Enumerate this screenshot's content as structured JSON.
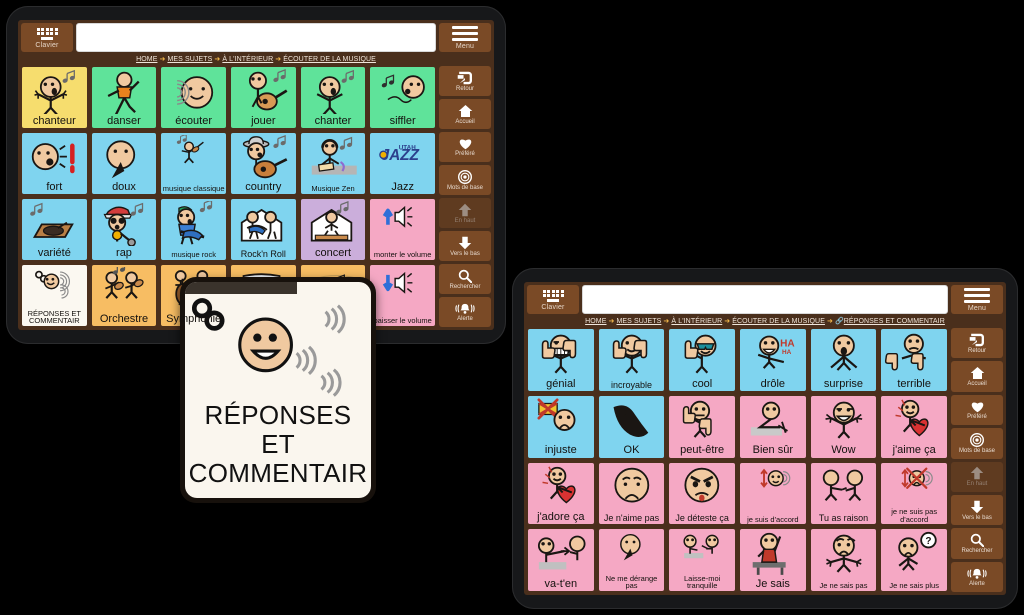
{
  "colors": {
    "bezel": "#17181a",
    "chrome_brown": "#4a2f1c",
    "key_brown": "#7a4a26",
    "yellow": "#f6dd6e",
    "green": "#5fe39a",
    "blue": "#7fd4ef",
    "pink": "#f5a8c4",
    "purple": "#cbaedb",
    "orange": "#f7bd63",
    "white": "#fbf8f1",
    "accent_arrow": "#f0b64a"
  },
  "topbar": {
    "keyboard_label": "Clavier",
    "keyboard_icon": "keyboard-icon",
    "menu_label": "Menu",
    "menu_icon": "hamburger-icon",
    "message_value": "",
    "message_placeholder": ""
  },
  "rail": {
    "items": [
      {
        "label": "Retour",
        "icon": "back-arrow-icon",
        "dim": false
      },
      {
        "label": "Accueil",
        "icon": "home-icon",
        "dim": false
      },
      {
        "label": "Préféré",
        "icon": "heart-icon",
        "dim": false
      },
      {
        "label": "Mots de base",
        "icon": "core-words-target-icon",
        "dim": false
      },
      {
        "label": "En haut",
        "icon": "arrow-up-icon",
        "dim": true
      },
      {
        "label": "Vers le bas",
        "icon": "arrow-down-icon",
        "dim": false
      },
      {
        "label": "Rechercher",
        "icon": "magnifier-icon",
        "dim": false
      },
      {
        "label": "Alerte",
        "icon": "bell-alert-icon",
        "dim": false
      }
    ]
  },
  "left_tablet": {
    "breadcrumb": [
      {
        "text": "HOME",
        "chain": false
      },
      {
        "text": "MES SUJETS",
        "chain": false
      },
      {
        "text": "À L'INTÉRIEUR",
        "chain": false
      },
      {
        "text": "ÉCOUTER DE LA MUSIQUE",
        "chain": false
      }
    ],
    "cells": [
      {
        "label": "chanteur",
        "color": "yellow",
        "size": "s1",
        "art": "singer"
      },
      {
        "label": "danser",
        "color": "green",
        "size": "s1",
        "art": "dance"
      },
      {
        "label": "écouter",
        "color": "green",
        "size": "s1",
        "art": "listen"
      },
      {
        "label": "jouer",
        "color": "green",
        "size": "s1",
        "art": "guitar"
      },
      {
        "label": "chanter",
        "color": "green",
        "size": "s1",
        "art": "sing"
      },
      {
        "label": "siffler",
        "color": "green",
        "size": "s1",
        "art": "whistle"
      },
      {
        "label": "fort",
        "color": "blue",
        "size": "s1",
        "art": "loud"
      },
      {
        "label": "doux",
        "color": "blue",
        "size": "s1",
        "art": "soft"
      },
      {
        "label": "musique classique",
        "color": "blue",
        "size": "s3",
        "art": "violin",
        "two": true
      },
      {
        "label": "country",
        "color": "blue",
        "size": "s1",
        "art": "country"
      },
      {
        "label": "Musique Zen",
        "color": "blue",
        "size": "s3",
        "art": "zen"
      },
      {
        "label": "Jazz",
        "color": "blue",
        "size": "s1",
        "art": "jazz"
      },
      {
        "label": "variété",
        "color": "blue",
        "size": "s1",
        "art": "gramophone"
      },
      {
        "label": "rap",
        "color": "blue",
        "size": "s1",
        "art": "rap"
      },
      {
        "label": "musique rock",
        "color": "blue",
        "size": "s3",
        "art": "rock"
      },
      {
        "label": "Rock'n Roll",
        "color": "blue",
        "size": "s2",
        "art": "rocknroll"
      },
      {
        "label": "concert",
        "color": "purple",
        "size": "s1",
        "art": "concert"
      },
      {
        "label": "monter le volume",
        "color": "pink",
        "size": "s3",
        "art": "volup",
        "two": true
      },
      {
        "label": "RÉPONSES ET COMMENTAIR",
        "color": "white",
        "size": "s3",
        "art": "comment",
        "two": true
      },
      {
        "label": "Orchestre",
        "color": "orange",
        "size": "s1",
        "art": "orchestra"
      },
      {
        "label": "Symphonie",
        "color": "orange",
        "size": "s1",
        "art": "symphony"
      },
      {
        "label": "",
        "color": "orange",
        "size": "s1",
        "art": "sheetmusic"
      },
      {
        "label": "",
        "color": "orange",
        "size": "s1",
        "art": "notes"
      },
      {
        "label": "baisser le volume",
        "color": "pink",
        "size": "s3",
        "art": "voldown",
        "two": true
      }
    ]
  },
  "right_tablet": {
    "breadcrumb": [
      {
        "text": "HOME",
        "chain": false
      },
      {
        "text": "MES SUJETS",
        "chain": false
      },
      {
        "text": "À L'INTÉRIEUR",
        "chain": false
      },
      {
        "text": "ÉCOUTER DE LA MUSIQUE",
        "chain": false
      },
      {
        "text": "RÉPONSES ET COMMENTAIR",
        "chain": true
      }
    ],
    "cells": [
      {
        "label": "génial",
        "color": "blue",
        "size": "s1",
        "art": "thumbsup-grin"
      },
      {
        "label": "incroyable",
        "color": "blue",
        "size": "s2",
        "art": "thumbsup-smile"
      },
      {
        "label": "cool",
        "color": "blue",
        "size": "s1",
        "art": "sunglasses"
      },
      {
        "label": "drôle",
        "color": "blue",
        "size": "s1",
        "art": "haha"
      },
      {
        "label": "surprise",
        "color": "blue",
        "size": "s1",
        "art": "surprise"
      },
      {
        "label": "terrible",
        "color": "blue",
        "size": "s1",
        "art": "thumbsdown"
      },
      {
        "label": "injuste",
        "color": "blue",
        "size": "s1",
        "art": "unfair"
      },
      {
        "label": "OK",
        "color": "blue",
        "size": "s1",
        "art": "ok-hand"
      },
      {
        "label": "peut-être",
        "color": "pink",
        "size": "s1",
        "art": "maybe"
      },
      {
        "label": "Bien sûr",
        "color": "pink",
        "size": "s1",
        "art": "ofcourse"
      },
      {
        "label": "Wow",
        "color": "pink",
        "size": "s1",
        "art": "wow"
      },
      {
        "label": "j'aime ça",
        "color": "pink",
        "size": "s1",
        "art": "love-heart"
      },
      {
        "label": "j'adore ça",
        "color": "pink",
        "size": "s1",
        "art": "love-heart"
      },
      {
        "label": "Je n'aime pas",
        "color": "pink",
        "size": "s2",
        "art": "sad-face"
      },
      {
        "label": "Je déteste ça",
        "color": "pink",
        "size": "s2",
        "art": "angry-face"
      },
      {
        "label": "je suis d'accord",
        "color": "pink",
        "size": "s3",
        "art": "agree",
        "two": true
      },
      {
        "label": "Tu as raison",
        "color": "pink",
        "size": "s2",
        "art": "youre-right"
      },
      {
        "label": "je ne suis pas d'accord",
        "color": "pink",
        "size": "s3",
        "art": "disagree",
        "two": true
      },
      {
        "label": "va-t'en",
        "color": "pink",
        "size": "s1",
        "art": "goaway"
      },
      {
        "label": "Ne me dérange pas",
        "color": "pink",
        "size": "s3",
        "art": "dontbother",
        "two": true
      },
      {
        "label": "Laisse-moi tranquille",
        "color": "pink",
        "size": "s3",
        "art": "leavemealone",
        "two": true
      },
      {
        "label": "Je sais",
        "color": "pink",
        "size": "s1",
        "art": "iknow"
      },
      {
        "label": "Je ne sais pas",
        "color": "pink",
        "size": "s3",
        "art": "dontknow"
      },
      {
        "label": "Je ne sais plus",
        "color": "pink",
        "size": "s3",
        "art": "dontknow-q"
      }
    ]
  },
  "callout": {
    "line1": "RÉPONSES ET",
    "line2": "COMMENTAIR",
    "icons": [
      "chain-link-icon",
      "talking-face-icon",
      "sound-waves-icon"
    ]
  }
}
